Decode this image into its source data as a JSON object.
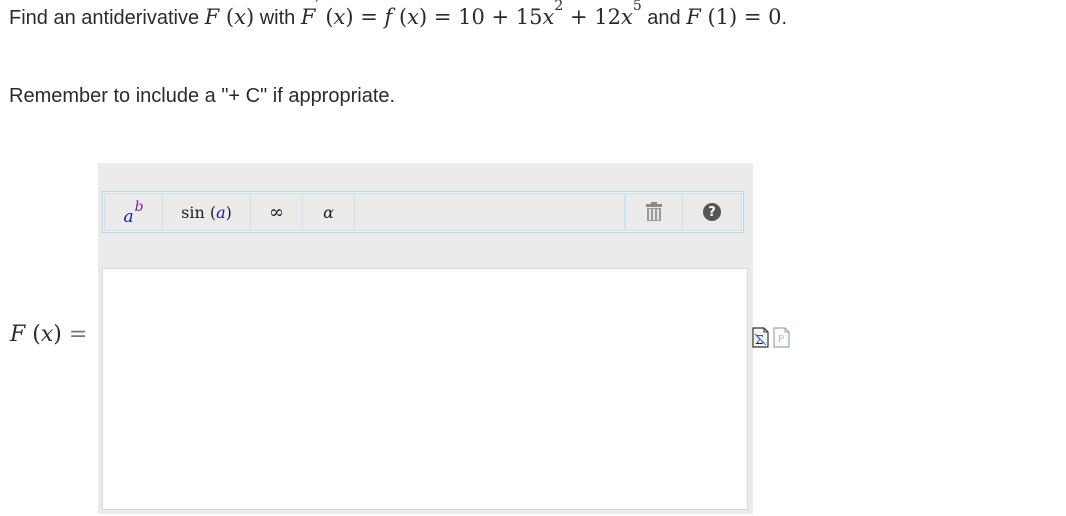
{
  "question": {
    "prefix": "Find an antiderivative",
    "with": "with",
    "and": "and",
    "period": "."
  },
  "reminder": "Remember to include a \"+ C\" if appropriate.",
  "answer_label": "F (x) =",
  "toolbar": {
    "trig_fn": "sin",
    "infinity": "∞",
    "greek": "α",
    "help": "?"
  },
  "answer_value": "",
  "icons": [
    "superscript-icon",
    "trash-icon",
    "help-icon",
    "equation-editor-icon",
    "preview-icon"
  ]
}
